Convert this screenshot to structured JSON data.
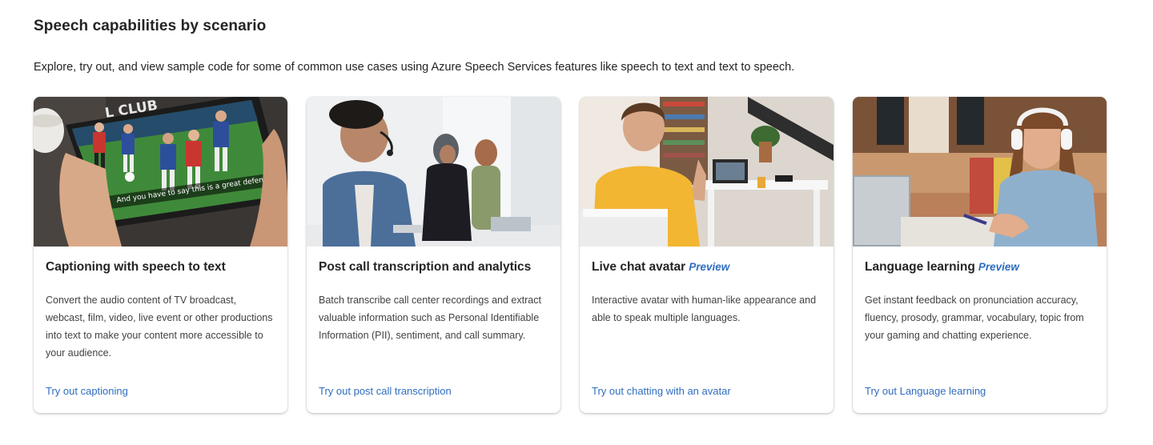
{
  "header": {
    "title": "Speech capabilities by scenario",
    "description": "Explore, try out, and view sample code for some of common use cases using Azure Speech Services features like speech to text and text to speech."
  },
  "cards": [
    {
      "title": "Captioning with speech to text",
      "badge": "",
      "description": "Convert the audio content of TV broadcast, webcast, film, video, live event or other productions into text to make your content more accessible to your audience.",
      "link": "Try out captioning",
      "image_caption": "And you have to say this is a great defender.",
      "image_sign": "L CLUB"
    },
    {
      "title": "Post call transcription and analytics",
      "badge": "",
      "description": "Batch transcribe call center recordings and extract valuable information such as Personal Identifiable Information (PII), sentiment, and call summary.",
      "link": "Try out post call transcription"
    },
    {
      "title": "Live chat avatar",
      "badge": "Preview",
      "description": "Interactive avatar with human-like appearance and able to speak multiple languages.",
      "link": "Try out chatting with an avatar"
    },
    {
      "title": "Language learning",
      "badge": "Preview",
      "description": "Get instant feedback on pronunciation accuracy, fluency, prosody, grammar, vocabulary, topic from your gaming and chatting experience.",
      "link": "Try out Language learning"
    }
  ],
  "colors": {
    "link": "#2f6dbf",
    "text": "#242424",
    "muted": "#424242"
  }
}
